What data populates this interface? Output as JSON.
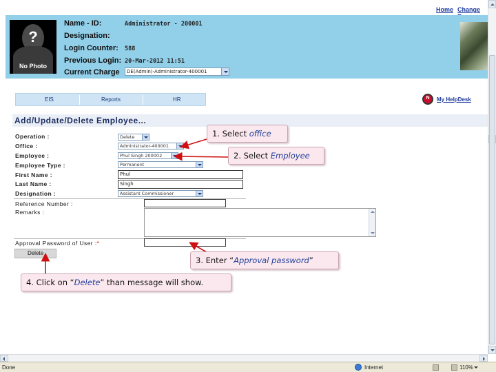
{
  "top_links": {
    "home": "Home",
    "change_password": "Change Pa"
  },
  "profile": {
    "photo_symbol": "?",
    "photo_label": "No Photo",
    "labels": {
      "name_id": "Name - ID:",
      "designation": "Designation:",
      "login_counter": "Login Counter:",
      "previous_login": "Previous Login:",
      "current_charge": "Current Charge"
    },
    "values": {
      "name_id": "Administrator - 200001",
      "designation": "",
      "login_counter": "588",
      "previous_login": "20-Mar-2012 11:51",
      "current_charge": "DE(Admin)-Administrator-400001"
    }
  },
  "menu": {
    "items": [
      "EIS",
      "Reports",
      "HR"
    ]
  },
  "helpdesk": {
    "logo_text": "N",
    "label": "My HelpDesk"
  },
  "form": {
    "title": "Add/Update/Delete Employee...",
    "labels": {
      "operation": "Operation :",
      "office": "Office :",
      "employee": "Employee :",
      "employee_type": "Employee Type :",
      "first_name": "First Name :",
      "last_name": "Last Name :",
      "designation": "Designation :",
      "reference_number": "Reference Number :",
      "remarks": "Remarks :",
      "approval_password": "Approval Password of User :",
      "approval_password_star": "*"
    },
    "values": {
      "operation": "Delete",
      "office": "Administrator-400001",
      "employee": "Phul Singh 200002",
      "employee_type": "Permanent",
      "first_name": "Phul",
      "last_name": "Singh",
      "designation": "Assistant Commissioner",
      "reference_number": "",
      "remarks": "",
      "approval_password": ""
    },
    "delete_button": "Delete"
  },
  "callouts": {
    "c1": {
      "prefix": "1. Select ",
      "emph": "office",
      "suffix": ""
    },
    "c2": {
      "prefix": "2. Select ",
      "emph": "Employee",
      "suffix": ""
    },
    "c3": {
      "prefix": "3. Enter “",
      "emph": "Approval password",
      "suffix": "”"
    },
    "c4": {
      "prefix": "4. Click on “",
      "emph": "Delete",
      "suffix": "” than message will show."
    }
  },
  "status_bar": {
    "status": "Done",
    "zone": "Internet",
    "zoom": "110%"
  },
  "colors": {
    "header_bg": "#92cfe8",
    "callout_bg": "#fbe8ee",
    "arrow": "#d01010",
    "link": "#1d3a9c"
  }
}
